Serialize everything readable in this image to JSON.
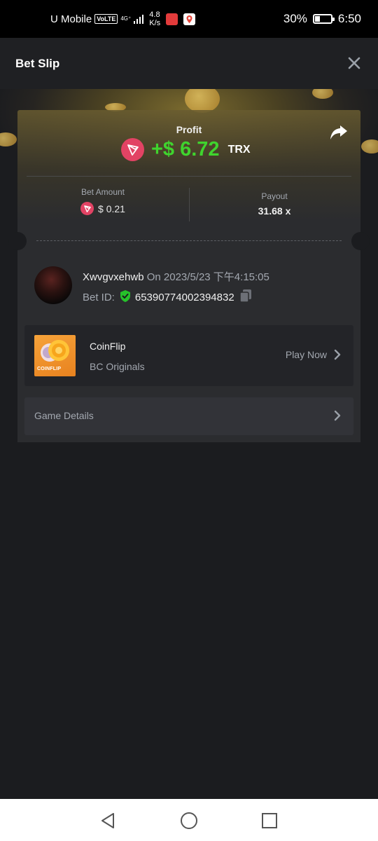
{
  "status_bar": {
    "carrier": "U Mobile",
    "volte": "VoLTE",
    "net_type": "4G⁺",
    "speed_value": "4.8",
    "speed_unit": "K/s",
    "battery": "30%",
    "battery_level": 0.3,
    "time": "6:50"
  },
  "header": {
    "title": "Bet Slip",
    "close_icon": "close-icon"
  },
  "slip": {
    "profit_label": "Profit",
    "profit_value": "+$ 6.72",
    "profit_currency": "TRX",
    "currency_icon": "trx-icon",
    "bet_amount_label": "Bet Amount",
    "bet_amount_value": "$ 0.21",
    "payout_label": "Payout",
    "payout_value": "31.68 x",
    "share_icon": "share-icon"
  },
  "bet_info": {
    "username": "Xwvgvxehwb",
    "on": "On",
    "date": "2023/5/23 下午4:15:05",
    "bet_id_label": "Bet ID:",
    "bet_id": "65390774002394832",
    "verified_icon": "shield-check-icon",
    "copy_icon": "copy-icon"
  },
  "game": {
    "thumb_text": "COINFLIP",
    "name": "CoinFlip",
    "provider": "BC Originals",
    "play_label": "Play Now"
  },
  "details": {
    "label": "Game Details"
  },
  "colors": {
    "profit_green": "#3fd42e",
    "trx_red": "#e24364",
    "background": "#1b1c1f",
    "card": "#2b2c2f"
  }
}
